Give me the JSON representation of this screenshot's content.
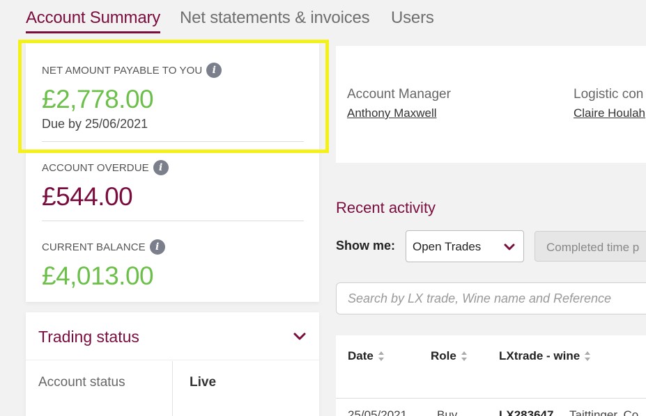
{
  "tabs": [
    {
      "label": "Account Summary",
      "active": true
    },
    {
      "label": "Net statements & invoices",
      "active": false
    },
    {
      "label": "Users",
      "active": false
    }
  ],
  "summary": {
    "net_payable": {
      "label": "NET AMOUNT PAYABLE TO YOU",
      "value": "£2,778.00",
      "due": "Due by 25/06/2021"
    },
    "overdue": {
      "label": "ACCOUNT OVERDUE",
      "value": "£544.00"
    },
    "balance": {
      "label": "CURRENT BALANCE",
      "value": "£4,013.00"
    },
    "info_icon_glyph": "i"
  },
  "trading_status": {
    "title": "Trading status",
    "row_label": "Account status",
    "row_value": "Live"
  },
  "contacts": [
    {
      "role": "Account Manager",
      "name": "Anthony Maxwell"
    },
    {
      "role": "Logistic con",
      "name": "Claire Houlah"
    }
  ],
  "recent_activity": {
    "title": "Recent activity",
    "show_me_label": "Show me:",
    "selected_filter": "Open Trades",
    "completed_button": "Completed time p",
    "search_placeholder": "Search by LX trade, Wine name and Reference"
  },
  "table": {
    "headers": [
      "Date",
      "Role",
      "LXtrade - wine"
    ],
    "first_row": {
      "date": "25/05/2021",
      "role": "Buy",
      "trade": "LX283647",
      "wine": "Taittinger, Co"
    }
  },
  "colors": {
    "accent": "#7a0d3e",
    "positive": "#6cc04a",
    "highlight": "#f4f11a"
  }
}
